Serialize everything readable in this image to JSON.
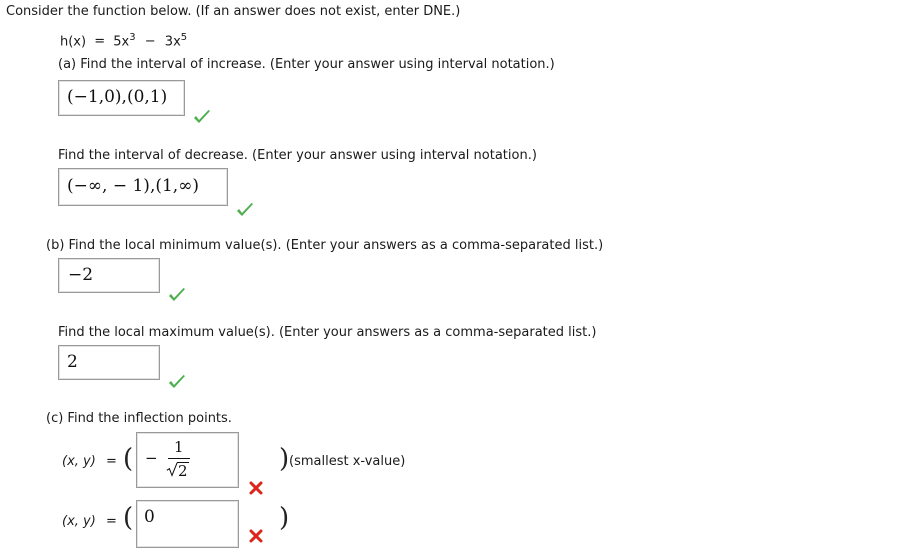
{
  "intro": "Consider the function below. (If an answer does not exist, enter DNE.)",
  "function": {
    "name": "h(x)",
    "equals": "=",
    "term1_base": "5x",
    "term1_exp": "3",
    "minus": "−",
    "term2_base": "3x",
    "term2_exp": "5"
  },
  "part_a": {
    "prompt": "(a) Find the interval of increase. (Enter your answer using interval notation.)",
    "answer": "(−1,0),(0,1)",
    "prompt2": "Find the interval of decrease. (Enter your answer using interval notation.)",
    "answer2": "(−∞, − 1),(1,∞)"
  },
  "part_b": {
    "prompt": "(b) Find the local minimum value(s). (Enter your answers as a comma-separated list.)",
    "answer": "−2",
    "prompt2": "Find the local maximum value(s). (Enter your answers as a comma-separated list.)",
    "answer2": "2"
  },
  "part_c": {
    "prompt": "(c) Find the inflection points.",
    "xy_label": "(x, y)",
    "equals": "=",
    "point1": {
      "minus": "−",
      "numerator": "1",
      "denominator": "2"
    },
    "point1_note": "(smallest x-value)",
    "point2": {
      "value": "0"
    }
  },
  "status_colors": {
    "correct": "#4cae4c",
    "incorrect": "#d9251d"
  }
}
